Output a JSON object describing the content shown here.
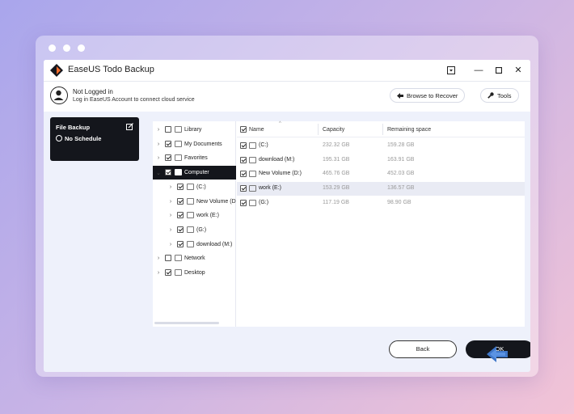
{
  "window": {
    "title": "EaseUS Todo Backup",
    "controls": [
      "dropdown-icon",
      "minimize-icon",
      "maximize-icon",
      "close-icon"
    ],
    "accent": "#14161c"
  },
  "account": {
    "status": "Not Logged in",
    "hint": "Log in EaseUS Account to connect cloud service",
    "browse_label": "Browse to Recover",
    "tools_label": "Tools"
  },
  "schedule": {
    "title": "File Backup",
    "subtitle": "No Schedule"
  },
  "tree": [
    {
      "label": "Library",
      "checked": false,
      "icon": "folder-icon",
      "indent": 0
    },
    {
      "label": "My Documents",
      "checked": true,
      "icon": "document-icon",
      "indent": 0
    },
    {
      "label": "Favorites",
      "checked": true,
      "icon": "favorites-icon",
      "indent": 0
    },
    {
      "label": "Computer",
      "checked": true,
      "icon": "computer-icon",
      "indent": 0,
      "selected": true,
      "expanded": true
    },
    {
      "label": "(C:)",
      "checked": true,
      "icon": "drive-icon",
      "indent": 1
    },
    {
      "label": "New Volume (D:)",
      "checked": true,
      "icon": "drive-icon",
      "indent": 1
    },
    {
      "label": "work (E:)",
      "checked": true,
      "icon": "drive-icon",
      "indent": 1
    },
    {
      "label": "(G:)",
      "checked": true,
      "icon": "drive-icon",
      "indent": 1
    },
    {
      "label": "download (M:)",
      "checked": true,
      "icon": "drive-icon",
      "indent": 1
    },
    {
      "label": "Network",
      "checked": false,
      "icon": "network-icon",
      "indent": 0
    },
    {
      "label": "Desktop",
      "checked": true,
      "icon": "desktop-icon",
      "indent": 0
    }
  ],
  "list": {
    "columns": [
      "Name",
      "Capacity",
      "Remaining space"
    ],
    "rows": [
      {
        "name": "(C:)",
        "capacity": "232.32 GB",
        "remaining": "159.28 GB"
      },
      {
        "name": "download (M:)",
        "capacity": "195.31 GB",
        "remaining": "163.91 GB"
      },
      {
        "name": "New Volume (D:)",
        "capacity": "465.76 GB",
        "remaining": "452.03 GB"
      },
      {
        "name": "work (E:)",
        "capacity": "153.29 GB",
        "remaining": "136.57 GB",
        "selected": true
      },
      {
        "name": "(G:)",
        "capacity": "117.19 GB",
        "remaining": "98.90 GB"
      }
    ]
  },
  "footer": {
    "back_label": "Back",
    "ok_label": "OK"
  }
}
